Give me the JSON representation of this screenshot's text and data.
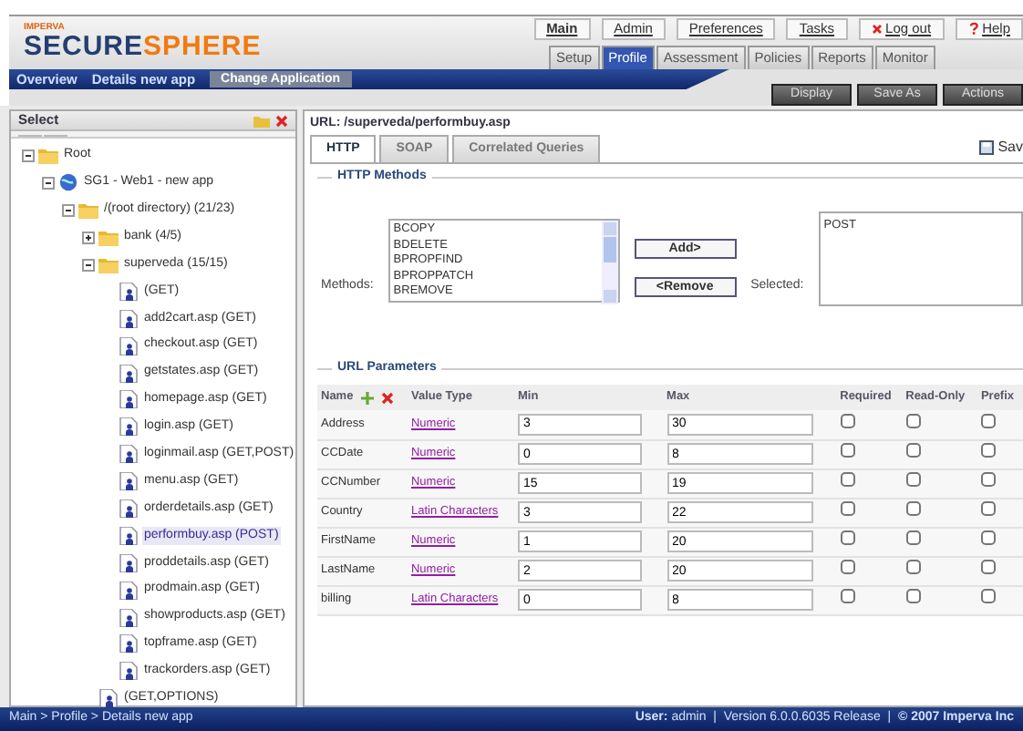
{
  "logo": {
    "maker": "IMPERVA",
    "first": "SECURE",
    "second": "SPHERE"
  },
  "top_links": [
    {
      "label": "Main",
      "bold": true,
      "kind": "plain"
    },
    {
      "label": "Admin",
      "bold": false,
      "kind": "plain"
    },
    {
      "label": "Preferences",
      "bold": false,
      "kind": "plain"
    },
    {
      "label": "Tasks",
      "bold": false,
      "kind": "plain"
    },
    {
      "label": "Log out",
      "bold": false,
      "kind": "logout"
    },
    {
      "label": "Help",
      "bold": false,
      "kind": "help"
    }
  ],
  "tabs": [
    {
      "label": "Setup",
      "selected": false
    },
    {
      "label": "Profile",
      "selected": true
    },
    {
      "label": "Assessment",
      "selected": false
    },
    {
      "label": "Policies",
      "selected": false
    },
    {
      "label": "Reports",
      "selected": false
    },
    {
      "label": "Monitor",
      "selected": false
    }
  ],
  "nav": {
    "items": [
      "Overview",
      "Details new app"
    ],
    "button": "Change Application"
  },
  "actions": [
    "Display",
    "Save As",
    "Actions"
  ],
  "sidebar": {
    "title": "Select",
    "tree": [
      {
        "label": "Root",
        "kind": "folder",
        "expanded": true,
        "selected": false,
        "children": [
          {
            "label": "SG1 - Web1 - new app",
            "kind": "site",
            "expanded": true,
            "selected": false,
            "children": [
              {
                "label": "/(root directory) (21/23)",
                "kind": "folder",
                "expanded": true,
                "selected": false,
                "children": [
                  {
                    "label": "bank (4/5)",
                    "kind": "folder",
                    "expanded": false,
                    "selected": false
                  },
                  {
                    "label": "superveda (15/15)",
                    "kind": "folder",
                    "expanded": true,
                    "selected": false,
                    "children": [
                      {
                        "label": "(GET)",
                        "kind": "page",
                        "selected": false
                      },
                      {
                        "label": "add2cart.asp (GET)",
                        "kind": "page",
                        "selected": false
                      },
                      {
                        "label": "checkout.asp (GET)",
                        "kind": "page",
                        "selected": false
                      },
                      {
                        "label": "getstates.asp (GET)",
                        "kind": "page",
                        "selected": false
                      },
                      {
                        "label": "homepage.asp (GET)",
                        "kind": "page",
                        "selected": false
                      },
                      {
                        "label": "login.asp (GET)",
                        "kind": "page",
                        "selected": false
                      },
                      {
                        "label": "loginmail.asp (GET,POST)",
                        "kind": "page",
                        "selected": false
                      },
                      {
                        "label": "menu.asp (GET)",
                        "kind": "page",
                        "selected": false
                      },
                      {
                        "label": "orderdetails.asp (GET)",
                        "kind": "page",
                        "selected": false
                      },
                      {
                        "label": "performbuy.asp (POST)",
                        "kind": "page",
                        "selected": true
                      },
                      {
                        "label": "proddetails.asp (GET)",
                        "kind": "page",
                        "selected": false
                      },
                      {
                        "label": "prodmain.asp (GET)",
                        "kind": "page",
                        "selected": false
                      },
                      {
                        "label": "showproducts.asp (GET)",
                        "kind": "page",
                        "selected": false
                      },
                      {
                        "label": "topframe.asp (GET)",
                        "kind": "page",
                        "selected": false
                      },
                      {
                        "label": "trackorders.asp (GET)",
                        "kind": "page",
                        "selected": false
                      }
                    ]
                  },
                  {
                    "label": "(GET,OPTIONS)",
                    "kind": "page",
                    "selected": false
                  }
                ]
              }
            ]
          }
        ]
      }
    ]
  },
  "url": "URL: /superveda/performbuy.asp",
  "content_tabs": [
    {
      "label": "HTTP",
      "selected": true
    },
    {
      "label": "SOAP",
      "selected": false
    },
    {
      "label": "Correlated Queries",
      "selected": false
    }
  ],
  "save": "Sav",
  "http_methods": {
    "title": "HTTP Methods",
    "methods_label": "Methods:",
    "available": [
      "BCOPY",
      "BDELETE",
      "BPROPFIND",
      "BPROPPATCH",
      "BREMOVE"
    ],
    "add": "Add>",
    "remove": "<Remove",
    "selected_label": "Selected:",
    "selected": [
      "POST"
    ]
  },
  "url_parameters": {
    "title": "URL Parameters",
    "columns": [
      "Name",
      "Value Type",
      "Min",
      "Max",
      "Required",
      "Read-Only",
      "Prefix"
    ],
    "rows": [
      {
        "name": "Address",
        "type": "Numeric",
        "min": "3",
        "max": "30",
        "required": false,
        "read_only": false,
        "prefix": false
      },
      {
        "name": "CCDate",
        "type": "Numeric",
        "min": "0",
        "max": "8",
        "required": false,
        "read_only": false,
        "prefix": false
      },
      {
        "name": "CCNumber",
        "type": "Numeric",
        "min": "15",
        "max": "19",
        "required": false,
        "read_only": false,
        "prefix": false
      },
      {
        "name": "Country",
        "type": "Latin Characters",
        "min": "3",
        "max": "22",
        "required": false,
        "read_only": false,
        "prefix": false
      },
      {
        "name": "FirstName",
        "type": "Numeric",
        "min": "1",
        "max": "20",
        "required": false,
        "read_only": false,
        "prefix": false
      },
      {
        "name": "LastName",
        "type": "Numeric",
        "min": "2",
        "max": "20",
        "required": false,
        "read_only": false,
        "prefix": false
      },
      {
        "name": "billing",
        "type": "Latin Characters",
        "min": "0",
        "max": "8",
        "required": false,
        "read_only": false,
        "prefix": false
      }
    ]
  },
  "status_bar": {
    "breadcrumb": "Main > Profile > Details new app",
    "info": "**User:** admin  |  Version 6.0.0.6035 Release  |  **© 2007 Imperva Inc**"
  }
}
